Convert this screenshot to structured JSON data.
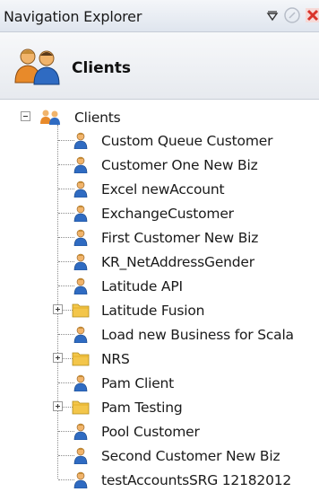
{
  "window": {
    "title": "Navigation Explorer"
  },
  "header": {
    "title": "Clients"
  },
  "tree": {
    "root": {
      "label": "Clients",
      "expanded": true
    },
    "items": [
      {
        "label": "Custom Queue Customer",
        "type": "customer"
      },
      {
        "label": "Customer One New Biz",
        "type": "customer"
      },
      {
        "label": "Excel newAccount",
        "type": "customer"
      },
      {
        "label": "ExchangeCustomer",
        "type": "customer"
      },
      {
        "label": "First Customer New Biz",
        "type": "customer"
      },
      {
        "label": "KR_NetAddressGender",
        "type": "customer"
      },
      {
        "label": "Latitude API",
        "type": "customer"
      },
      {
        "label": "Latitude Fusion",
        "type": "folder",
        "expandable": true
      },
      {
        "label": "Load new Business for Scala",
        "type": "customer"
      },
      {
        "label": "NRS",
        "type": "folder",
        "expandable": true
      },
      {
        "label": "Pam Client",
        "type": "customer"
      },
      {
        "label": "Pam Testing",
        "type": "folder",
        "expandable": true
      },
      {
        "label": "Pool Customer",
        "type": "customer"
      },
      {
        "label": "Second Customer New Biz",
        "type": "customer"
      },
      {
        "label": "testAccountsSRG 12182012",
        "type": "customer"
      }
    ]
  },
  "colors": {
    "accent_close": "#d9342b",
    "folder": "#f3c64a",
    "person_shirt": "#2f6bc2",
    "person_skin": "#f1b46b"
  }
}
